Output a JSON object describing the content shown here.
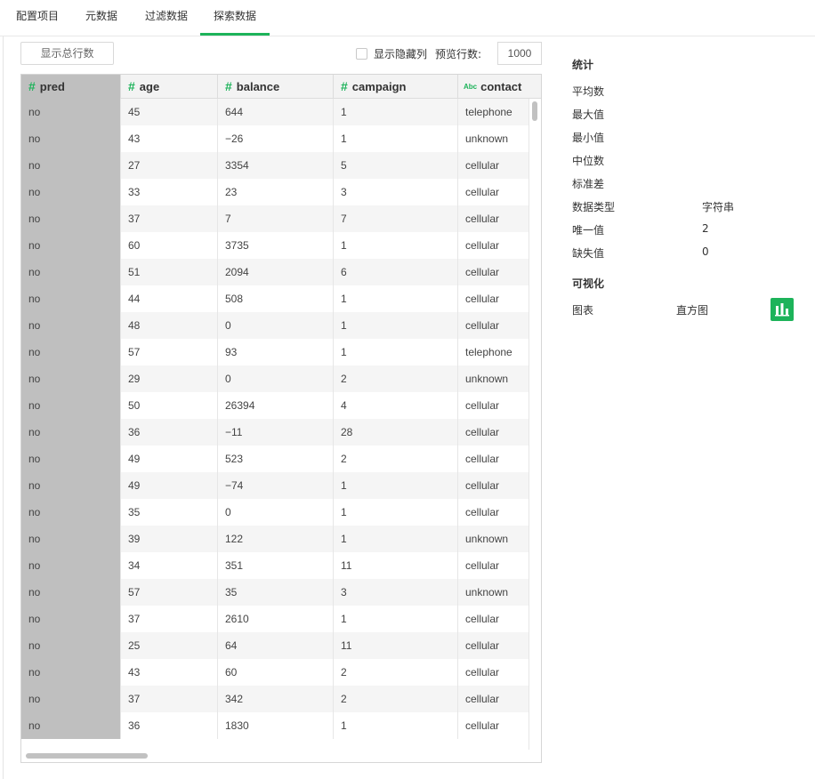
{
  "tabs": [
    {
      "label": "配置项目"
    },
    {
      "label": "元数据"
    },
    {
      "label": "过滤数据"
    },
    {
      "label": "探索数据"
    }
  ],
  "toolbar": {
    "show_total_label": "显示总行数",
    "show_hidden_label": "显示隐藏列",
    "preview_rows_label": "预览行数:",
    "preview_rows_value": "1000"
  },
  "table": {
    "columns": [
      {
        "name": "pred",
        "type_icon": "#"
      },
      {
        "name": "age",
        "type_icon": "#"
      },
      {
        "name": "balance",
        "type_icon": "#"
      },
      {
        "name": "campaign",
        "type_icon": "#"
      },
      {
        "name": "contact",
        "type_icon": "Abc"
      }
    ],
    "rows": [
      [
        "no",
        "45",
        "644",
        "1",
        "telephone"
      ],
      [
        "no",
        "43",
        "−26",
        "1",
        "unknown"
      ],
      [
        "no",
        "27",
        "3354",
        "5",
        "cellular"
      ],
      [
        "no",
        "33",
        "23",
        "3",
        "cellular"
      ],
      [
        "no",
        "37",
        "7",
        "7",
        "cellular"
      ],
      [
        "no",
        "60",
        "3735",
        "1",
        "cellular"
      ],
      [
        "no",
        "51",
        "2094",
        "6",
        "cellular"
      ],
      [
        "no",
        "44",
        "508",
        "1",
        "cellular"
      ],
      [
        "no",
        "48",
        "0",
        "1",
        "cellular"
      ],
      [
        "no",
        "57",
        "93",
        "1",
        "telephone"
      ],
      [
        "no",
        "29",
        "0",
        "2",
        "unknown"
      ],
      [
        "no",
        "50",
        "26394",
        "4",
        "cellular"
      ],
      [
        "no",
        "36",
        "−11",
        "28",
        "cellular"
      ],
      [
        "no",
        "49",
        "523",
        "2",
        "cellular"
      ],
      [
        "no",
        "49",
        "−74",
        "1",
        "cellular"
      ],
      [
        "no",
        "35",
        "0",
        "1",
        "cellular"
      ],
      [
        "no",
        "39",
        "122",
        "1",
        "unknown"
      ],
      [
        "no",
        "34",
        "351",
        "11",
        "cellular"
      ],
      [
        "no",
        "57",
        "35",
        "3",
        "unknown"
      ],
      [
        "no",
        "37",
        "2610",
        "1",
        "cellular"
      ],
      [
        "no",
        "25",
        "64",
        "11",
        "cellular"
      ],
      [
        "no",
        "43",
        "60",
        "2",
        "cellular"
      ],
      [
        "no",
        "37",
        "342",
        "2",
        "cellular"
      ],
      [
        "no",
        "36",
        "1830",
        "1",
        "cellular"
      ]
    ]
  },
  "stats": {
    "title": "统计",
    "items": [
      {
        "label": "平均数",
        "value": ""
      },
      {
        "label": "最大值",
        "value": ""
      },
      {
        "label": "最小值",
        "value": ""
      },
      {
        "label": "中位数",
        "value": ""
      },
      {
        "label": "标准差",
        "value": ""
      },
      {
        "label": "数据类型",
        "value": "字符串"
      },
      {
        "label": "唯一值",
        "value": "2"
      },
      {
        "label": "缺失值",
        "value": "0"
      }
    ]
  },
  "visualization": {
    "title": "可视化",
    "chart_label": "图表",
    "chart_type": "直方图",
    "chart_icon": "bar-chart-icon"
  },
  "colors": {
    "accent": "#1db35a",
    "selected_column": "#bfbfbf"
  }
}
